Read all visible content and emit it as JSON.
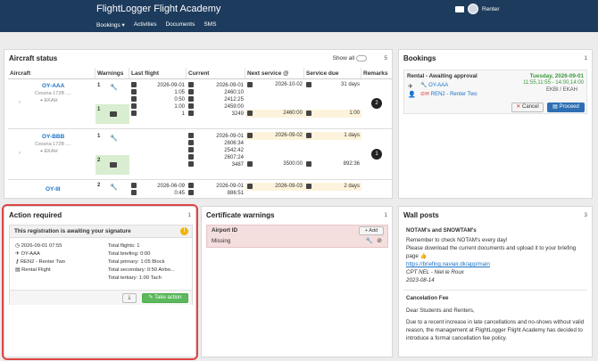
{
  "app": {
    "title": "FlightLogger Flight Academy",
    "user": "Renter",
    "mail_icon": "mail-icon"
  },
  "nav": {
    "items": [
      "Bookings ▾",
      "Activities",
      "Documents",
      "SMS"
    ]
  },
  "aircraft_status": {
    "title": "Aircraft status",
    "show_all": "Show all",
    "count": "5",
    "columns": [
      "Aircraft",
      "Warnings",
      "Last flight",
      "Current",
      "Next service @",
      "Service due",
      "Remarks"
    ],
    "rows": [
      {
        "reg": "OY-AAA",
        "type": "Cessna 172B ....",
        "base": "EKAH",
        "warnings": [
          "1",
          "1"
        ],
        "last_flight": [
          "2026-09-01",
          "1:05",
          "0:50",
          "1:00",
          "1"
        ],
        "current": [
          "2026-09-01",
          "2460:10",
          "2412:25",
          "2459:00",
          "3249"
        ],
        "next_service": [
          "2026-10-02",
          "2460:00"
        ],
        "service_due": [
          "31 days",
          "1:00"
        ],
        "remarks": "2"
      },
      {
        "reg": "OY-BBB",
        "type": "Cessna 172B ....",
        "base": "EKAH",
        "warnings": [
          "1",
          "2"
        ],
        "last_flight": [],
        "current": [
          "2026-09-01",
          "2606:34",
          "2542:42",
          "2607:24",
          "3487"
        ],
        "next_service": [
          "2026-09-02",
          "3500:00"
        ],
        "service_due": [
          "1 days",
          "892:36"
        ],
        "remarks": "1"
      },
      {
        "reg": "OY-III",
        "type": "",
        "base": "",
        "warnings": [
          "2"
        ],
        "last_flight": [
          "2026-06-09",
          "0:45"
        ],
        "current": [
          "2026-09-01",
          "886:51"
        ],
        "next_service": [
          "2026-09-03"
        ],
        "service_due": [
          "2 days"
        ],
        "remarks": ""
      }
    ]
  },
  "bookings": {
    "title": "Bookings",
    "count": "1",
    "item": {
      "label": "Rental - Awaiting approval",
      "date": "Tuesday, 2026-09-01",
      "time": "11:55,11:55 - 14:00,14:00",
      "route": "EKBI / EKAH",
      "aircraft": "OY-AAA",
      "renter": "REN2 - Renter Two"
    },
    "cancel": "Cancel",
    "proceed": "Proceed"
  },
  "action_required": {
    "title": "Action required",
    "count": "1",
    "message": "This registration is awaiting your signature",
    "left": [
      "2026-09-01 07:55",
      "OY-AAA",
      "REN2 - Renter Two",
      "Rental Flight"
    ],
    "right": [
      "Total flights: 1",
      "Total briefing: 0:00",
      "Total primary: 1:05 Block",
      "Total secondary: 0:50 Airbo...",
      "Total tertiary: 1:00 Tach"
    ],
    "take_action": "Take action"
  },
  "certificate_warnings": {
    "title": "Certificate warnings",
    "count": "1",
    "head": "Airport ID",
    "add": "+ Add",
    "value": "Missing"
  },
  "wall_posts": {
    "title": "Wall posts",
    "count": "3",
    "post1": {
      "title": "NOTAM's and SNOWTAM's",
      "lines": [
        "Remember to check NOTAM's every day!",
        "Please download the current documents and upload it to your briefing page 👍"
      ],
      "link": "https://briefing.naviair.dk/app/main",
      "author": "CPT NEL - Niel le Roux",
      "date": "2023-08-14"
    },
    "post2": {
      "title": "Cancelation Fee",
      "lines": [
        "Dear Students and Renters,",
        "Due to a recent increase in late cancellations and no-shows without valid reason, the management at FlightLogger Flight Academy has decided to introduce a formal cancellation fee policy."
      ]
    }
  }
}
